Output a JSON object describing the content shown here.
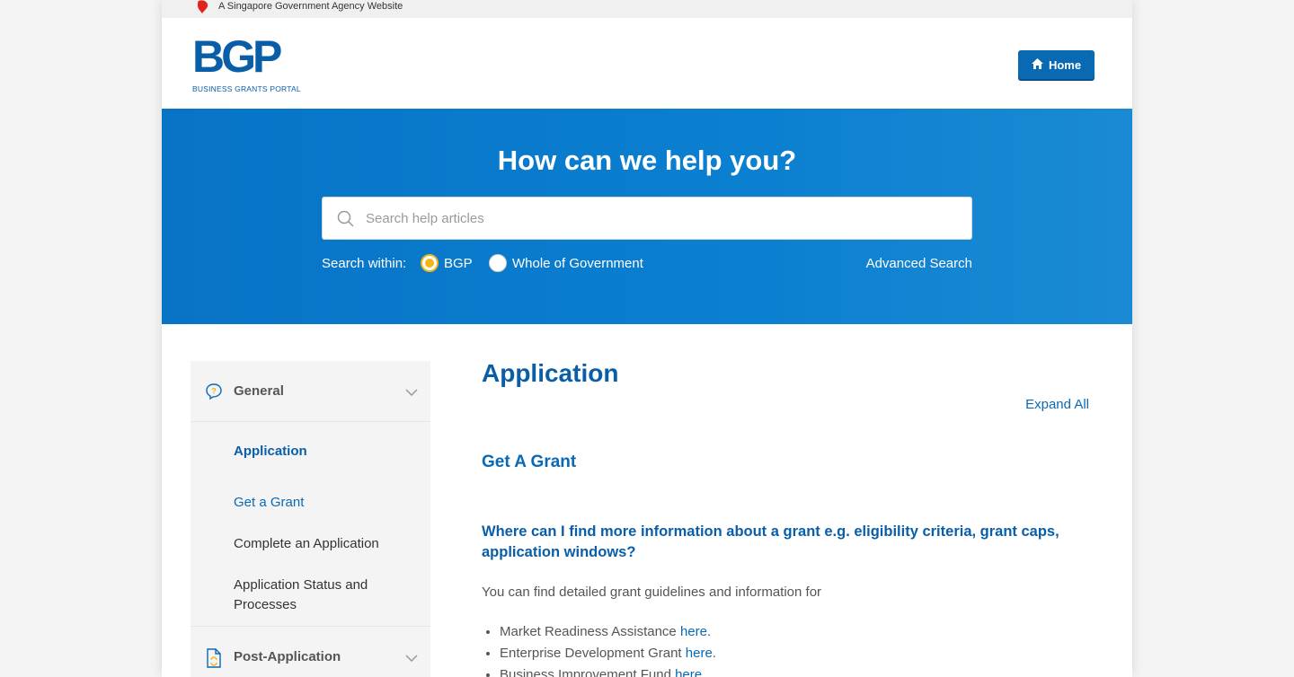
{
  "masthead": {
    "text": "A Singapore Government Agency Website"
  },
  "logo": {
    "mark": "BGP",
    "subtitle": "BUSINESS GRANTS PORTAL"
  },
  "header": {
    "home_label": "Home"
  },
  "hero": {
    "title": "How can we help you?",
    "search_placeholder": "Search help articles",
    "search_within_label": "Search within:",
    "options": [
      "BGP",
      "Whole of Government"
    ],
    "selected": "BGP",
    "advanced_label": "Advanced Search"
  },
  "sidebar": {
    "sections": [
      {
        "title": "General",
        "icon": "question-bubble-icon"
      },
      {
        "title": "Post-Application",
        "icon": "document-refresh-icon"
      }
    ],
    "items": [
      {
        "label": "Application"
      },
      {
        "label": "Get a Grant"
      },
      {
        "label": "Complete an Application"
      },
      {
        "label": "Application Status and Processes"
      }
    ]
  },
  "main": {
    "title": "Application",
    "expand_all": "Expand All",
    "section_title": "Get A Grant",
    "question": "Where can I find more information about a grant e.g. eligibility criteria, grant caps, application windows?",
    "intro": "You can find detailed grant guidelines and information for",
    "list": [
      {
        "text": "Market Readiness Assistance ",
        "link": "here",
        "suffix": "."
      },
      {
        "text": "Enterprise Development Grant ",
        "link": "here",
        "suffix": "."
      },
      {
        "text": "Business Improvement Fund ",
        "link": "here",
        "suffix": "."
      }
    ]
  },
  "colors": {
    "primary": "#0a69b3",
    "hero": "#0b7fd0",
    "accent": "#f3b51a"
  }
}
